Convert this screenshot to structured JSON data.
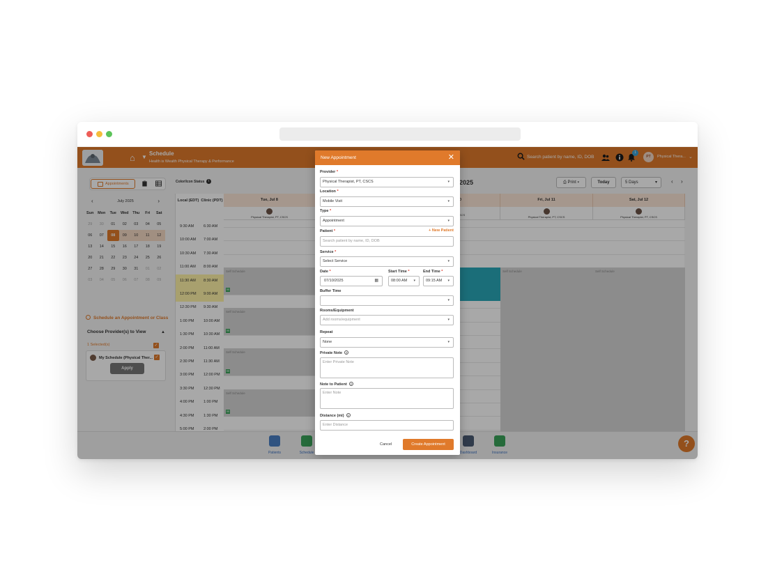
{
  "header": {
    "title": "Schedule",
    "subtitle": "Health is Wealth Physical Therapy & Performance",
    "search_placeholder": "Search patient by name, ID, DOB",
    "notification_count": "1",
    "user_initials": "PT",
    "user_name": "Physical Thera..."
  },
  "sidebar": {
    "view_label": "Appointments",
    "calendar": {
      "month": "July 2025",
      "dow": [
        "Sun",
        "Mon",
        "Tue",
        "Wed",
        "Thu",
        "Fri",
        "Sat"
      ],
      "weeks": [
        [
          "29",
          "30",
          "01",
          "02",
          "03",
          "04",
          "05"
        ],
        [
          "06",
          "07",
          "08",
          "09",
          "10",
          "11",
          "12"
        ],
        [
          "13",
          "14",
          "15",
          "16",
          "17",
          "18",
          "19"
        ],
        [
          "20",
          "21",
          "22",
          "23",
          "24",
          "25",
          "26"
        ],
        [
          "27",
          "28",
          "29",
          "30",
          "31",
          "01",
          "02"
        ],
        [
          "03",
          "04",
          "05",
          "06",
          "07",
          "08",
          "09"
        ]
      ],
      "selected": "08"
    },
    "schedule_link": "Schedule an Appointment or Class",
    "choose_label": "Choose Provider(s) to View",
    "selected_count": "1 Selected(s)",
    "provider_name": "My Schedule (Physical Ther...",
    "apply_label": "Apply"
  },
  "schedule": {
    "color_icon_status": "Color/Icon Status",
    "range_text": "2025",
    "print_label": "Print",
    "today_label": "Today",
    "days_label": "5 Days",
    "local_header": "Local (EDT)",
    "clinic_header": "Clinic (PDT)",
    "times_local": [
      "9:30 AM",
      "10:00 AM",
      "10:30 AM",
      "11:00 AM",
      "11:30 AM",
      "12:00 PM",
      "12:30 PM",
      "1:00 PM",
      "1:30 PM",
      "2:00 PM",
      "2:30 PM",
      "3:00 PM",
      "3:30 PM",
      "4:00 PM",
      "4:30 PM",
      "5:00 PM"
    ],
    "times_clinic": [
      "6:30 AM",
      "7:00 AM",
      "7:30 AM",
      "8:00 AM",
      "8:30 AM",
      "9:00 AM",
      "9:30 AM",
      "10:00 AM",
      "10:30 AM",
      "11:00 AM",
      "11:30 AM",
      "12:00 PM",
      "12:30 PM",
      "1:00 PM",
      "1:30 PM",
      "2:00 PM"
    ],
    "days": [
      {
        "label": "Tue, Jul 8",
        "provider": "Physical Therapist, PT, CSCS"
      },
      {
        "label": "10",
        "provider": "CSCS"
      },
      {
        "label": "Fri, Jul 11",
        "provider": "Physical Therapist, PT, CSCS"
      },
      {
        "label": "Sat, Jul 12",
        "provider": "Physical Therapist, PT, CSCS"
      }
    ],
    "block_label": "Self Schedule",
    "block_marker": "M"
  },
  "bottom_nav": {
    "patients": "Patients",
    "schedule": "Schedule",
    "dashboard": "Dashboard",
    "insurance": "Insurance",
    "help": "?"
  },
  "modal": {
    "title": "New Appointment",
    "provider_label": "Provider",
    "provider_value": "Physical Therapist, PT, CSCS",
    "location_label": "Location",
    "location_value": "Mobile Visit",
    "type_label": "Type",
    "type_value": "Appointment",
    "patient_label": "Patient",
    "new_patient_label": "New Patient",
    "patient_placeholder": "Search patient by name, ID, DOB",
    "service_label": "Service",
    "service_value": "Select Service",
    "date_label": "Date",
    "date_value": "07/10/2025",
    "start_label": "Start Time",
    "start_value": "08:00 AM",
    "end_label": "End Time",
    "end_value": "09:15 AM",
    "buffer_label": "Buffer Time",
    "rooms_label": "Rooms/Equipment",
    "rooms_placeholder": "Add rooms/equipment",
    "repeat_label": "Repeat",
    "repeat_value": "None",
    "private_note_label": "Private Note",
    "private_note_placeholder": "Enter Private Note",
    "note_patient_label": "Note to Patient",
    "note_patient_placeholder": "Enter Note",
    "distance_label": "Distance (mi)",
    "distance_placeholder": "Enter Distance",
    "cancel_label": "Cancel",
    "create_label": "Create Appointment"
  },
  "colors": {
    "brand": "#e07a2b",
    "teal": "#2aa8b8"
  }
}
